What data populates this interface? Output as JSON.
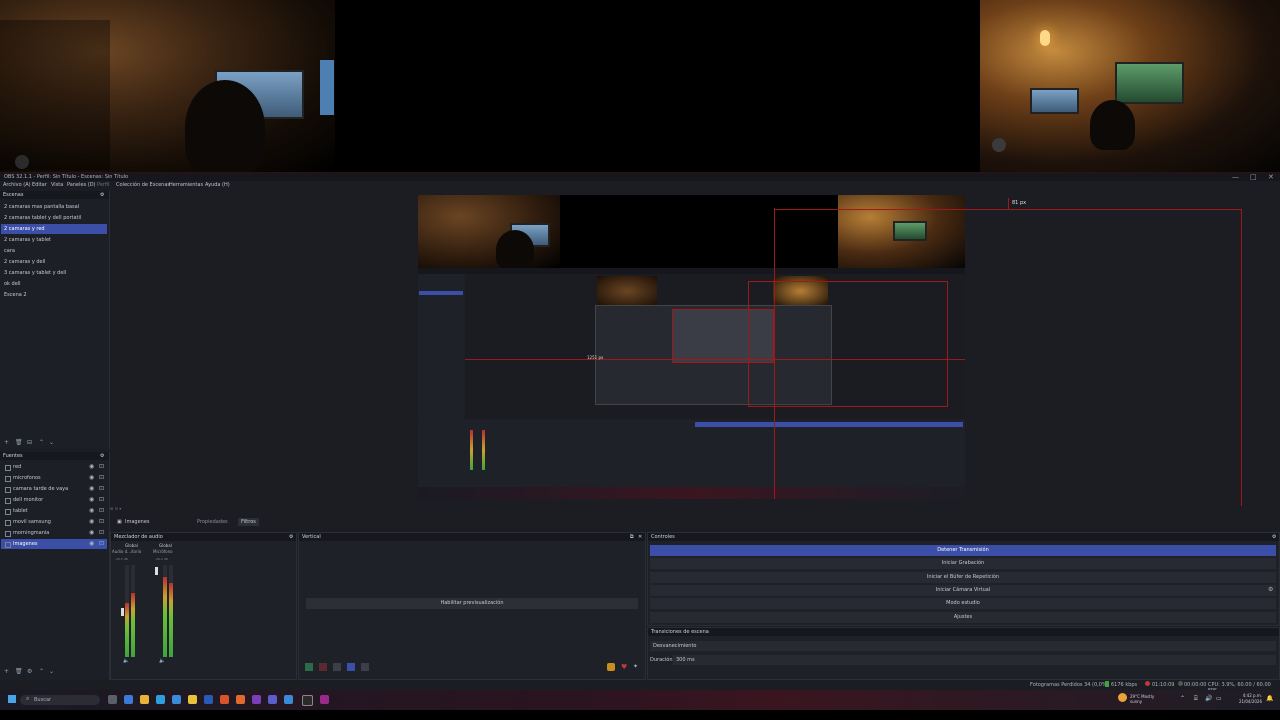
{
  "window": {
    "title": "OBS 32.1.1 - Perfil: Sin Título - Escenas: Sin Título",
    "controls": [
      "—",
      "□",
      "✕"
    ]
  },
  "menu": [
    "Archivo (A)",
    "Editar",
    "Vista",
    "Paneles (D)",
    "Perfil",
    "Colección de Escenas",
    "Herramientas",
    "Ayuda (H)"
  ],
  "scenes": {
    "header": "Escenas",
    "items": [
      "2 camaras mas pantalla basal",
      "2 camaras tablet y dell portatil",
      "2 camaras y red",
      "2 camaras y tablet",
      "cara",
      "2 camaras y dell",
      "3 camaras y tablet y dell",
      "ok dell",
      "Escena 2"
    ],
    "selected_index": 2
  },
  "sources": {
    "header": "Fuentes",
    "items": [
      {
        "label": "red"
      },
      {
        "label": "microfonos"
      },
      {
        "label": "camara tarde de vaya"
      },
      {
        "label": "dell monitor"
      },
      {
        "label": "tablet"
      },
      {
        "label": "movil samsung"
      },
      {
        "label": "morningmania"
      },
      {
        "label": "Imagenes"
      }
    ],
    "selected_index": 7
  },
  "preview": {
    "size_label": "81 px",
    "inner_label": "1251 px"
  },
  "source_toolbar": {
    "selected": "Imagenes",
    "properties": "Propiedades",
    "filters": "Filtros"
  },
  "mixer": {
    "header": "Mezclador de audio",
    "channel1": "Global",
    "channel2": "Global",
    "ch1_name": "Audio d...itorio",
    "ch2_name": "Micrófono",
    "db1": "-20.5 dB",
    "db2": "-26.2 dB",
    "menu": "Opciones",
    "footer": "0 Mixer"
  },
  "vertical": {
    "header": "Vertical",
    "button": "Habilitar previsualización"
  },
  "controls": {
    "header": "Controles",
    "buttons": [
      "Detener Transmisión",
      "Iniciar Grabación",
      "Iniciar el Búfer de Repetición",
      "Iniciar Cámara Virtual",
      "Modo estudio",
      "Ajustes"
    ]
  },
  "transitions": {
    "header": "Transiciones de escena",
    "transition": "Desvanecimiento",
    "duration_label": "Duración",
    "duration_value": "300 ms"
  },
  "status": {
    "dropped": "Fotogramas Perdidos 34 (0,0%)",
    "bitrate": "6176 kbps",
    "live": "01:10:09",
    "rec": "00:00:00",
    "cpu": "CPU: 3.9%,  60.00 / 60.00 FPS"
  },
  "taskbar": {
    "search": "Buscar",
    "weather": "29°C Mostly sunny",
    "time": "4:42 p.m.",
    "date": "21/04/2026"
  },
  "colors": {
    "accent": "#3c4fa8",
    "red_guides": "#a01818",
    "background": "#1b1d23"
  }
}
